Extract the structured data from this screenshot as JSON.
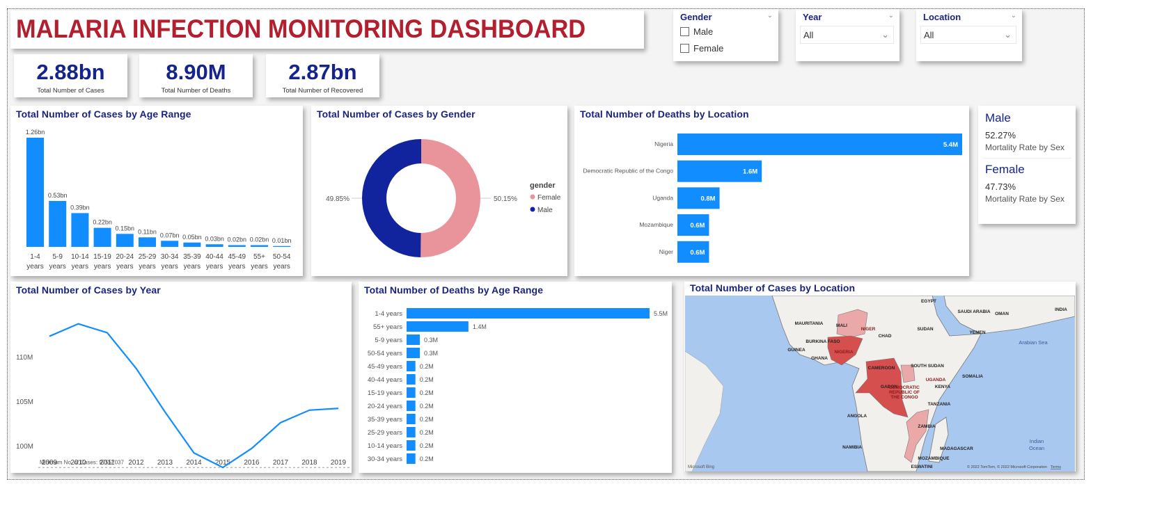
{
  "header": {
    "title": "MALARIA INFECTION MONITORING DASHBOARD",
    "title_color": "#B22030"
  },
  "kpis": [
    {
      "value": "2.88bn",
      "label": "Total Number of Cases"
    },
    {
      "value": "8.90M",
      "label": "Total Number of Deaths"
    },
    {
      "value": "2.87bn",
      "label": "Total Number of Recovered"
    }
  ],
  "slicers": {
    "gender": {
      "label": "Gender",
      "options": [
        "Male",
        "Female"
      ]
    },
    "year": {
      "label": "Year",
      "value": "All"
    },
    "location": {
      "label": "Location",
      "value": "All"
    }
  },
  "mortality": {
    "male": {
      "label": "Male",
      "value": "52.27%",
      "caption": "Mortality Rate by Sex"
    },
    "female": {
      "label": "Female",
      "value": "47.73%",
      "caption": "Mortality Rate by Sex"
    }
  },
  "colors": {
    "bar": "#118DFF",
    "male": "#12239E",
    "female": "#E8949A",
    "map_strong": "#D64F4F",
    "map_light": "#EBA8A8"
  },
  "chart_data": [
    {
      "type": "bar",
      "title": "Total Number of Cases by Age Range",
      "categories": [
        "1-4 years",
        "5-9 years",
        "10-14 years",
        "15-19 years",
        "20-24 years",
        "25-29 years",
        "30-34 years",
        "35-39 years",
        "40-44 years",
        "45-49 years",
        "55+ years",
        "50-54 years"
      ],
      "values": [
        1.26,
        0.53,
        0.39,
        0.22,
        0.15,
        0.11,
        0.07,
        0.05,
        0.03,
        0.02,
        0.02,
        0.01
      ],
      "labels": [
        "1.26bn",
        "0.53bn",
        "0.39bn",
        "0.22bn",
        "0.15bn",
        "0.11bn",
        "0.07bn",
        "0.05bn",
        "0.03bn",
        "0.02bn",
        "0.02bn",
        "0.01bn"
      ],
      "unit": "bn"
    },
    {
      "type": "pie",
      "title": "Total Number of Cases by Gender",
      "legend_title": "gender",
      "legend_position": "right",
      "slices": [
        {
          "name": "Female",
          "value": 50.15,
          "label": "50.15%"
        },
        {
          "name": "Male",
          "value": 49.85,
          "label": "49.85%"
        }
      ]
    },
    {
      "type": "bar",
      "orientation": "horizontal",
      "title": "Total Number of Deaths by Location",
      "categories": [
        "Nigeria",
        "Democratic Republic of the Congo",
        "Uganda",
        "Mozambique",
        "Niger"
      ],
      "values": [
        5.4,
        1.6,
        0.8,
        0.6,
        0.6
      ],
      "labels": [
        "5.4M",
        "1.6M",
        "0.8M",
        "0.6M",
        "0.6M"
      ]
    },
    {
      "type": "line",
      "title": "Total Number of Cases by Year",
      "x": [
        2009,
        2010,
        2011,
        2012,
        2013,
        2014,
        2015,
        2016,
        2017,
        2018,
        2019
      ],
      "y": [
        112.3,
        113.7,
        112.7,
        108.7,
        103.8,
        99.2,
        97.56,
        99.7,
        102.6,
        104.0,
        104.2
      ],
      "unit": "M",
      "yticks": [
        "100M",
        "105M",
        "110M"
      ],
      "ylim": [
        97,
        115
      ],
      "reference_line": {
        "value": 97.557037,
        "label": "Minimum No. of Cases: 97557037"
      }
    },
    {
      "type": "bar",
      "orientation": "horizontal",
      "title": "Total Number of Deaths by Age Range",
      "categories": [
        "1-4 years",
        "55+ years",
        "5-9 years",
        "50-54 years",
        "45-49 years",
        "40-44 years",
        "15-19 years",
        "20-24 years",
        "35-39 years",
        "25-29 years",
        "10-14 years",
        "30-34 years"
      ],
      "values": [
        5.5,
        1.4,
        0.3,
        0.3,
        0.2,
        0.2,
        0.2,
        0.2,
        0.2,
        0.2,
        0.2,
        0.2
      ],
      "labels": [
        "5.5M",
        "1.4M",
        "0.3M",
        "0.3M",
        "0.2M",
        "0.2M",
        "0.2M",
        "0.2M",
        "0.2M",
        "0.2M",
        "0.2M",
        "0.2M"
      ]
    }
  ],
  "map": {
    "title": "Total Number of Cases by Location",
    "labels": [
      "EGYPT",
      "SAUDI ARABIA",
      "OMAN",
      "INDIA",
      "MAURITANIA",
      "MALI",
      "NIGER",
      "SUDAN",
      "YEMEN",
      "CHAD",
      "BURKINA FASO",
      "Arabian Sea",
      "GUINEA",
      "NIGERIA",
      "GHANA",
      "SOUTH SUDAN",
      "CAMEROON",
      "SOMALIA",
      "UGANDA",
      "KENYA",
      "GABON",
      "DEMOCRATIC",
      "REPUBLIC OF",
      "THE CONGO",
      "TANZANIA",
      "ANGOLA",
      "ZAMBIA",
      "NAMIBIA",
      "MADAGASCAR",
      "MOZAMBIQUE",
      "ESWATINI",
      "Indian",
      "Ocean"
    ],
    "attribution": "© 2022 TomTom, © 2022 Microsoft Corporation",
    "terms": "Terms",
    "brand": "Microsoft Bing"
  }
}
